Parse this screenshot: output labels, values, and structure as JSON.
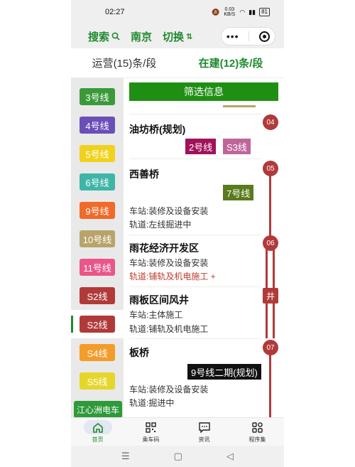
{
  "status": {
    "time": "02:27",
    "speed": "0.03 KB/S",
    "battery": "81"
  },
  "header": {
    "search_label": "搜索",
    "city_label": "南京",
    "switch_label": "切换",
    "capsule_more": "•••"
  },
  "tabs": [
    {
      "label": "运营(15)条/段"
    },
    {
      "label": "在建(12)条/段"
    }
  ],
  "sidebar": {
    "lines": [
      {
        "label": "3号线",
        "color": "#3a9a3a"
      },
      {
        "label": "4号线",
        "color": "#6a4fb8"
      },
      {
        "label": "5号线",
        "color": "#f0d21e"
      },
      {
        "label": "6号线",
        "color": "#3fb5a8"
      },
      {
        "label": "9号线",
        "color": "#f06a2a"
      },
      {
        "label": "10号线",
        "color": "#b8a46a"
      },
      {
        "label": "11号线",
        "color": "#e9578a"
      },
      {
        "label": "S2线",
        "color": "#b03a3a"
      },
      {
        "label": "S2线",
        "color": "#b03a3a"
      },
      {
        "label": "S4线",
        "color": "#f39c2a"
      },
      {
        "label": "S5线",
        "color": "#e6d62a"
      },
      {
        "label": "江心洲电车",
        "color": "#2e9a3a"
      }
    ]
  },
  "main": {
    "filter_label": "筛选信息",
    "stations": [
      {
        "name": "油坊桥(规划)",
        "badge": "04",
        "tags": [
          {
            "label": "2号线",
            "color": "#a0125a"
          },
          {
            "label": "S3线",
            "color": "#c0659a"
          }
        ],
        "lines": []
      },
      {
        "name": "西善桥",
        "badge": "05",
        "tags": [
          {
            "label": "7号线",
            "color": "#5a7a1e"
          }
        ],
        "lines": [
          {
            "text": "车站:装修及设备安装",
            "highlight": false
          },
          {
            "text": "轨道:左线掘进中",
            "highlight": false
          }
        ]
      },
      {
        "name": "雨花经济开发区",
        "badge": "06",
        "tags": [],
        "lines": [
          {
            "text": "车站:装修及设备安装",
            "highlight": false
          },
          {
            "text": "轨道:铺轨及机电施工 +",
            "highlight": true
          }
        ]
      },
      {
        "name": "雨板区间风井",
        "badge": "井",
        "tags": [],
        "lines": [
          {
            "text": "车站:主体施工",
            "highlight": false
          },
          {
            "text": "轨道:铺轨及机电施工",
            "highlight": false
          }
        ]
      },
      {
        "name": "板桥",
        "badge": "07",
        "tags": [
          {
            "label": "9号线二期(规划)",
            "color": "#111111"
          }
        ],
        "lines": [
          {
            "text": "车站:装修及设备安装",
            "highlight": false
          },
          {
            "text": "轨道:掘进中",
            "highlight": false
          }
        ]
      }
    ]
  },
  "bottomnav": [
    {
      "label": "首页",
      "icon": "home-icon"
    },
    {
      "label": "乘车码",
      "icon": "qr-code-icon"
    },
    {
      "label": "资讯",
      "icon": "message-icon"
    },
    {
      "label": "程序集",
      "icon": "apps-icon"
    }
  ],
  "sysnav": {
    "menu": "☰",
    "home": "▢",
    "back": "◁"
  }
}
